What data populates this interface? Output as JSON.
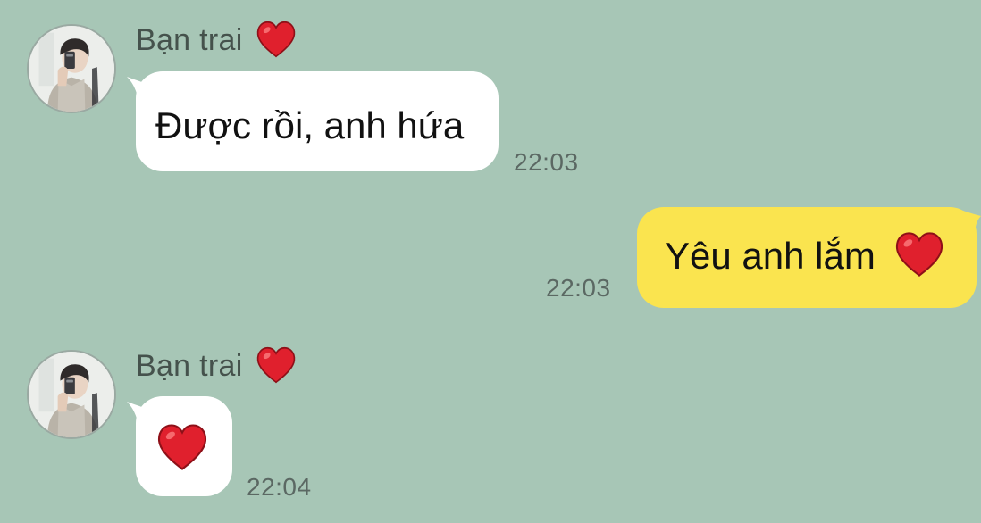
{
  "colors": {
    "background": "#a7c6b6",
    "incoming_bubble": "#ffffff",
    "outgoing_bubble": "#fae44f",
    "heart": "#e0202d"
  },
  "messages": [
    {
      "direction": "incoming",
      "sender": "Bạn trai",
      "sender_icon": "heart-icon",
      "avatar": "avatar",
      "text": "Được rồi, anh hứa",
      "time": "22:03"
    },
    {
      "direction": "outgoing",
      "text": "Yêu anh lắm",
      "text_icon": "heart-icon",
      "time": "22:03"
    },
    {
      "direction": "incoming",
      "sender": "Bạn trai",
      "sender_icon": "heart-icon",
      "avatar": "avatar",
      "text_icon": "heart-icon",
      "time": "22:04"
    }
  ]
}
